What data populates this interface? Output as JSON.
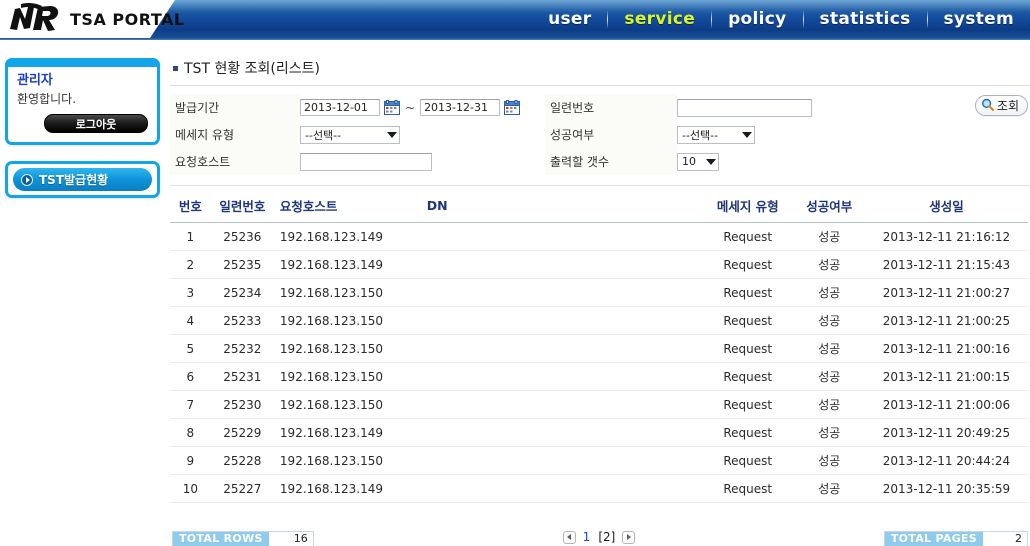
{
  "header": {
    "logo_text": "TSA PORTAL",
    "logo_mark": "mr-monogram-logo",
    "nav": [
      {
        "label": "user",
        "active": false
      },
      {
        "label": "service",
        "active": true
      },
      {
        "label": "policy",
        "active": false
      },
      {
        "label": "statistics",
        "active": false
      },
      {
        "label": "system",
        "active": false
      }
    ],
    "accent_color": "#d8f425",
    "banner_color": "#12489a"
  },
  "sidebar": {
    "user_name": "관리자",
    "welcome_text": "환영합니다.",
    "logout_label": "로그아웃",
    "menu": [
      {
        "label": "TST발급현황"
      }
    ],
    "border_color": "#12a5e8"
  },
  "main": {
    "page_title": "TST 현황 조회(리스트)",
    "form": {
      "period_label": "발급기간",
      "period_from": "2013-12-01",
      "period_to": "2013-12-31",
      "period_separator": "~",
      "msgtype_label": "메세지 유형",
      "msgtype_value": "--선택--",
      "host_label": "요청호스트",
      "host_value": "",
      "host_placeholder": "",
      "serial_label": "일련번호",
      "serial_value": "",
      "serial_placeholder": "",
      "success_label": "성공여부",
      "success_value": "--선택--",
      "count_label": "출력할 갯수",
      "count_value": "10",
      "search_label": "조회",
      "search_icon": "magnifier-icon"
    },
    "table": {
      "columns": [
        "번호",
        "일련번호",
        "요청호스트",
        "DN",
        "메세지 유형",
        "성공여부",
        "생성일"
      ],
      "rows": [
        {
          "no": "1",
          "serial": "25236",
          "host": "192.168.123.149",
          "dn": "",
          "type": "Request",
          "success": "성공",
          "created": "2013-12-11 21:16:12"
        },
        {
          "no": "2",
          "serial": "25235",
          "host": "192.168.123.149",
          "dn": "",
          "type": "Request",
          "success": "성공",
          "created": "2013-12-11 21:15:43"
        },
        {
          "no": "3",
          "serial": "25234",
          "host": "192.168.123.150",
          "dn": "",
          "type": "Request",
          "success": "성공",
          "created": "2013-12-11 21:00:27"
        },
        {
          "no": "4",
          "serial": "25233",
          "host": "192.168.123.150",
          "dn": "",
          "type": "Request",
          "success": "성공",
          "created": "2013-12-11 21:00:25"
        },
        {
          "no": "5",
          "serial": "25232",
          "host": "192.168.123.150",
          "dn": "",
          "type": "Request",
          "success": "성공",
          "created": "2013-12-11 21:00:16"
        },
        {
          "no": "6",
          "serial": "25231",
          "host": "192.168.123.150",
          "dn": "",
          "type": "Request",
          "success": "성공",
          "created": "2013-12-11 21:00:15"
        },
        {
          "no": "7",
          "serial": "25230",
          "host": "192.168.123.150",
          "dn": "",
          "type": "Request",
          "success": "성공",
          "created": "2013-12-11 21:00:06"
        },
        {
          "no": "8",
          "serial": "25229",
          "host": "192.168.123.149",
          "dn": "",
          "type": "Request",
          "success": "성공",
          "created": "2013-12-11 20:49:25"
        },
        {
          "no": "9",
          "serial": "25228",
          "host": "192.168.123.150",
          "dn": "",
          "type": "Request",
          "success": "성공",
          "created": "2013-12-11 20:44:24"
        },
        {
          "no": "10",
          "serial": "25227",
          "host": "192.168.123.149",
          "dn": "",
          "type": "Request",
          "success": "성공",
          "created": "2013-12-11 20:35:59"
        }
      ]
    },
    "footer": {
      "total_rows_label": "TOTAL ROWS",
      "total_rows_value": "16",
      "total_pages_label": "TOTAL PAGES",
      "total_pages_value": "2",
      "prev_icon": "arrow-left-icon",
      "next_icon": "arrow-right-icon",
      "pages": [
        {
          "label": "1",
          "current": false
        },
        {
          "label": "[2]",
          "current": true
        }
      ]
    }
  }
}
